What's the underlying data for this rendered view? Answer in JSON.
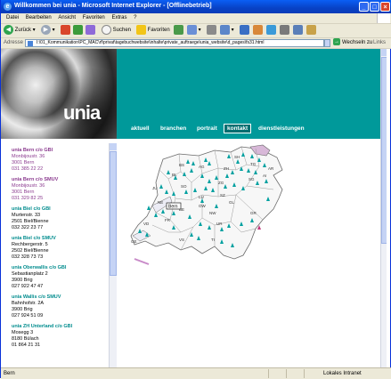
{
  "window": {
    "title": "Willkommen bei unia - Microsoft Internet Explorer - [Offlinebetrieb]",
    "min": "_",
    "max": "□",
    "close": "×"
  },
  "menu": [
    "Datei",
    "Bearbeiten",
    "Ansicht",
    "Favoriten",
    "Extras",
    "?"
  ],
  "toolbar": {
    "back": "Zurück",
    "search": "Suchen",
    "favorites": "Favoriten"
  },
  "address": {
    "label": "Adresse",
    "url": "I:\\01_Kommunikation\\PC_MAC\\rf\\privat\\tagebuchwebsite\\inhalte\\private_auftraege\\unia_website\\d_pages\\fs31.html",
    "go": "Wechseln zu",
    "links": "Links"
  },
  "header": {
    "logo": "unia",
    "nav": [
      "aktuell",
      "branchen",
      "portrait",
      "kontakt",
      "dienstleistungen"
    ],
    "active": "kontakt"
  },
  "contacts": [
    {
      "name": "unia Bern c/o GBI",
      "lines": [
        "Monbijoustr. 36",
        "3001 Bern",
        "031 385 22 22"
      ],
      "color": "purple"
    },
    {
      "name": "unia Bern c/o SMUV",
      "lines": [
        "Monbijoustr. 36",
        "3001 Bern",
        "031 329 82 25"
      ],
      "color": "purple"
    },
    {
      "name": "unia Biel c/o GBI",
      "lines": [
        "Murtenstr. 33",
        "2501 Biel/Bienne",
        "032 322 23 77"
      ],
      "color": "teal"
    },
    {
      "name": "unia Biel c/o SMUV",
      "lines": [
        "Rechbergerstr. 5",
        "2502 Biel/Bienne",
        "032 328 73 73"
      ],
      "color": "teal"
    },
    {
      "name": "unia Oberwallis c/o GBI",
      "lines": [
        "Sebastianplatz 2",
        "3900 Brig",
        "027 922 47 47"
      ],
      "color": "teal"
    },
    {
      "name": "unia Wallis c/o SMUV",
      "lines": [
        "Bahnhofstr. 2A",
        "3900 Brig",
        "027 924 51 09"
      ],
      "color": "teal"
    },
    {
      "name": "unia ZH Unterland c/o GBI",
      "lines": [
        "Mosegg 3",
        "8180 Bülach",
        "01 864 21 31"
      ],
      "color": "teal"
    }
  ],
  "map": {
    "cantons": [
      "BS",
      "SH",
      "TG",
      "BL",
      "AG",
      "ZH",
      "AR",
      "AI",
      "JU",
      "SO",
      "LU",
      "ZG",
      "SZ",
      "SG",
      "NE",
      "BE",
      "OW",
      "NW",
      "GL",
      "UR",
      "FR",
      "VD",
      "GR",
      "TI",
      "GE",
      "VS"
    ],
    "highlight_label": "Bern"
  },
  "status": {
    "left": "Bern",
    "right": "Lokales Intranet"
  },
  "colors": {
    "teal": "#00999a",
    "purple": "#8b3b8f",
    "marker": "#00a0a0",
    "highlight": "#c0367a"
  }
}
